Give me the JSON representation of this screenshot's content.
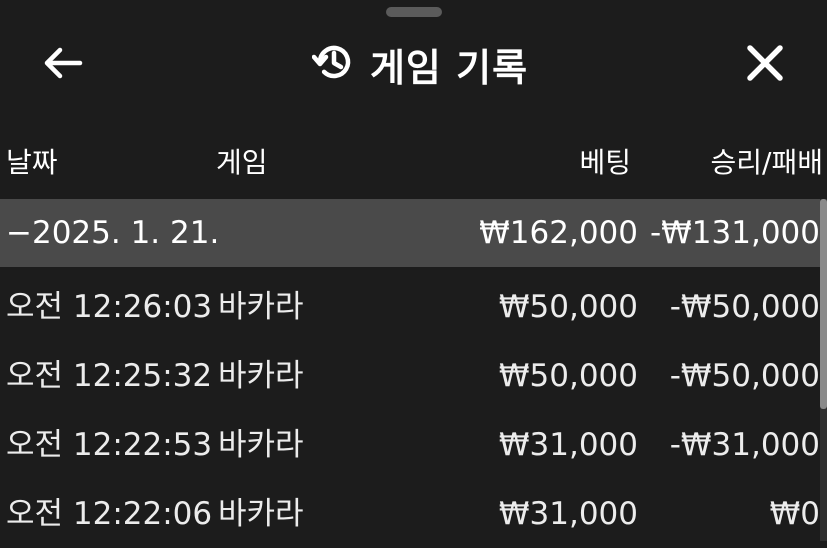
{
  "header": {
    "title": "게임 기록",
    "back_icon": "arrow-left-icon",
    "history_icon": "history-icon",
    "close_icon": "close-icon"
  },
  "columns": {
    "date": "날짜",
    "game": "게임",
    "bet": "베팅",
    "result": "승리/패배"
  },
  "group": {
    "date": "−2025. 1. 21.",
    "bet": "₩162,000",
    "result": "-₩131,000"
  },
  "rows": [
    {
      "time": "오전 12:26:03",
      "game": "바카라",
      "bet": "₩50,000",
      "result": "-₩50,000"
    },
    {
      "time": "오전 12:25:32",
      "game": "바카라",
      "bet": "₩50,000",
      "result": "-₩50,000"
    },
    {
      "time": "오전 12:22:53",
      "game": "바카라",
      "bet": "₩31,000",
      "result": "-₩31,000"
    },
    {
      "time": "오전 12:22:06",
      "game": "바카라",
      "bet": "₩31,000",
      "result": "₩0"
    }
  ],
  "colors": {
    "background": "#1c1c1c",
    "group_row": "#4a4a4a",
    "text": "#ffffff"
  }
}
